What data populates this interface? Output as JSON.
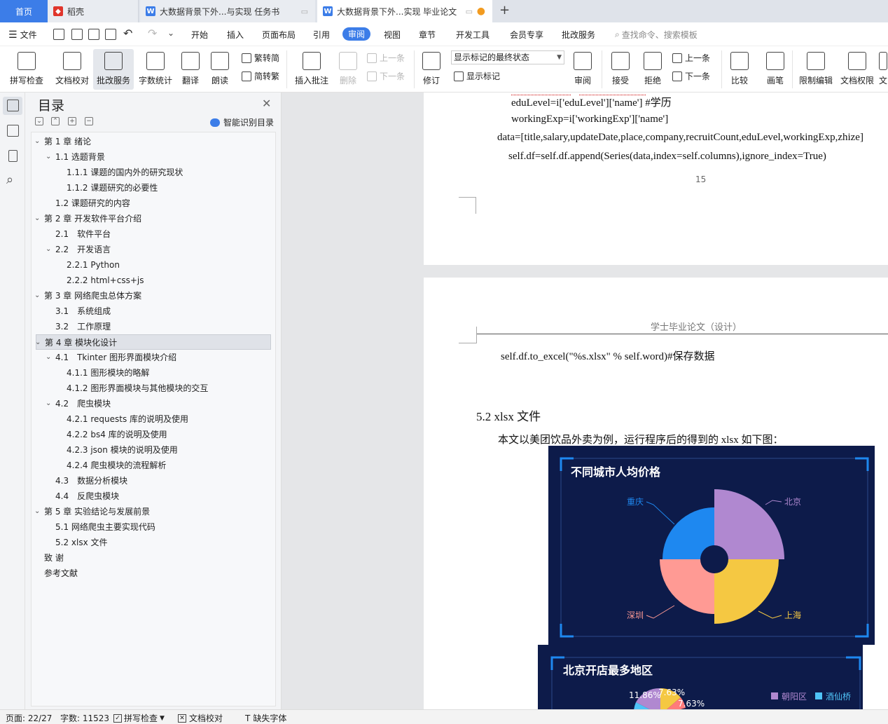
{
  "tabs": {
    "home": "首页",
    "docer": "稻壳",
    "doc1": "大数据背景下外...与实现 任务书",
    "doc2": "大数据背景下外...实现 毕业论文"
  },
  "menu": {
    "file": "文件",
    "items": [
      "开始",
      "插入",
      "页面布局",
      "引用",
      "审阅",
      "视图",
      "章节",
      "开发工具",
      "会员专享",
      "批改服务"
    ],
    "active": "审阅",
    "search": "查找命令、搜索模板"
  },
  "ribbon": {
    "spell": "拼写检查",
    "proof": "文档校对",
    "review_service": "批改服务",
    "wordcount": "字数统计",
    "translate": "翻译",
    "read": "朗读",
    "trad": "繁转简",
    "simp": "简转繁",
    "insert_comment": "插入批注",
    "delete": "删除",
    "prev_comment": "上一条",
    "next_comment": "下一条",
    "track": "修订",
    "display_select": "显示标记的最终状态",
    "show_markup": "显示标记",
    "review": "审阅",
    "accept": "接受",
    "reject": "拒绝",
    "prev_change": "上一条",
    "next_change": "下一条",
    "compare": "比较",
    "pen": "画笔",
    "restrict": "限制编辑",
    "doc_perm": "文档权限",
    "more": "文"
  },
  "toc": {
    "title": "目录",
    "smart": "智能识别目录",
    "items": [
      {
        "text": "第 1 章 绪论",
        "level": 0,
        "caret": true
      },
      {
        "text": "1.1 选题背景",
        "level": 1,
        "caret": true
      },
      {
        "text": "1.1.1 课题的国内外的研究现状",
        "level": 2
      },
      {
        "text": "1.1.2 课题研究的必要性",
        "level": 2
      },
      {
        "text": "1.2 课题研究的内容",
        "level": 1
      },
      {
        "text": "第 2 章 开发软件平台介绍",
        "level": 0,
        "caret": true
      },
      {
        "text": "2.1　软件平台",
        "level": 1
      },
      {
        "text": "2.2　开发语言",
        "level": 1,
        "caret": true
      },
      {
        "text": "2.2.1 Python",
        "level": 2
      },
      {
        "text": "2.2.2 html+css+js",
        "level": 2
      },
      {
        "text": "第 3 章 网络爬虫总体方案",
        "level": 0,
        "caret": true
      },
      {
        "text": "3.1　系统组成",
        "level": 1
      },
      {
        "text": "3.2　工作原理",
        "level": 1
      },
      {
        "text": "第 4 章 模块化设计",
        "level": 0,
        "caret": true,
        "selected": true
      },
      {
        "text": "4.1　Tkinter 图形界面模块介绍",
        "level": 1,
        "caret": true
      },
      {
        "text": "4.1.1 图形模块的略解",
        "level": 2
      },
      {
        "text": "4.1.2 图形界面模块与其他模块的交互",
        "level": 2
      },
      {
        "text": "4.2　爬虫模块",
        "level": 1,
        "caret": true
      },
      {
        "text": "4.2.1 requests 库的说明及使用",
        "level": 2
      },
      {
        "text": "4.2.2 bs4 库的说明及使用",
        "level": 2
      },
      {
        "text": "4.2.3 json 模块的说明及使用",
        "level": 2
      },
      {
        "text": "4.2.4 爬虫模块的流程解析",
        "level": 2
      },
      {
        "text": "4.3　数据分析模块",
        "level": 1
      },
      {
        "text": "4.4　反爬虫模块",
        "level": 1
      },
      {
        "text": "第 5 章 实验结论与发展前景",
        "level": 0,
        "caret": true
      },
      {
        "text": "5.1 网络爬虫主要实现代码",
        "level": 1
      },
      {
        "text": "5.2 xlsx 文件",
        "level": 1
      },
      {
        "text": "致  谢",
        "level": 0
      },
      {
        "text": "参考文献",
        "level": 0
      }
    ]
  },
  "doc": {
    "line_edu": "eduLevel=i['eduLevel']['name']   #学历",
    "line_work": "workingExp=i['workingExp']['name']",
    "line_data": "data=[title,salary,updateDate,place,company,recruitCount,eduLevel,workingExp,zhize]",
    "line_append": "self.df=self.df.append(Series(data,index=self.columns),ignore_index=True)",
    "page_num": "15",
    "header": "学士毕业论文（设计）",
    "line_excel": "self.df.to_excel(\"%s.xlsx\" % self.word)#保存数据",
    "heading": "5.2 xlsx 文件",
    "para": "本文以美团饮品外卖为例，运行程序后的得到的 xlsx 如下图："
  },
  "chart_data": [
    {
      "type": "pie",
      "title": "不同城市人均价格",
      "categories": [
        "北京",
        "上海",
        "深圳",
        "重庆"
      ],
      "values": [
        25,
        25,
        25,
        25
      ],
      "radii": [
        1.0,
        0.92,
        0.78,
        0.74
      ],
      "colors": {
        "北京": "#b088d0",
        "上海": "#f5c842",
        "深圳": "#ff9a94",
        "重庆": "#1e88f0"
      }
    },
    {
      "type": "pie",
      "title": "北京开店最多地区",
      "labels": [
        "11.86%",
        "7.63%",
        "7.63%"
      ],
      "legend": [
        "朝阳区",
        "酒仙桥"
      ],
      "legend_colors": [
        "#b088d0",
        "#4fc3f7"
      ]
    }
  ],
  "status": {
    "page": "页面: 22/27",
    "words": "字数: 11523",
    "spell": "拼写检查",
    "proof": "文档校对",
    "font": "缺失字体"
  }
}
